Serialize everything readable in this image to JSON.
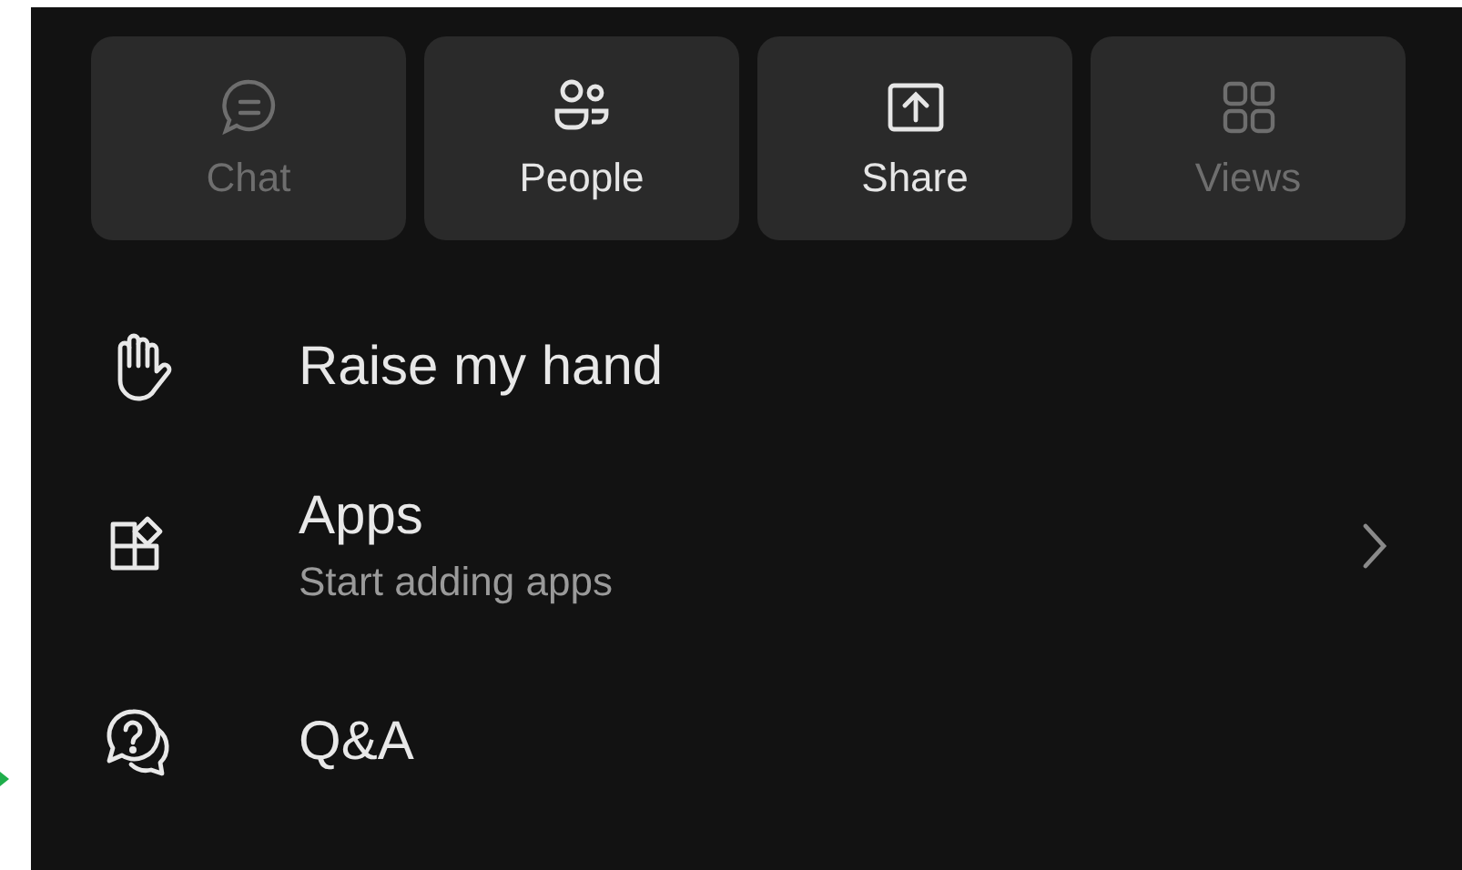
{
  "tiles": [
    {
      "label": "Chat",
      "disabled": true
    },
    {
      "label": "People",
      "disabled": false
    },
    {
      "label": "Share",
      "disabled": false
    },
    {
      "label": "Views",
      "disabled": true
    }
  ],
  "menu_items": [
    {
      "kind": "plain",
      "title": "Raise my hand"
    },
    {
      "kind": "nav",
      "title": "Apps",
      "subtitle": "Start adding apps"
    },
    {
      "kind": "plain",
      "title": "Q&A"
    }
  ]
}
